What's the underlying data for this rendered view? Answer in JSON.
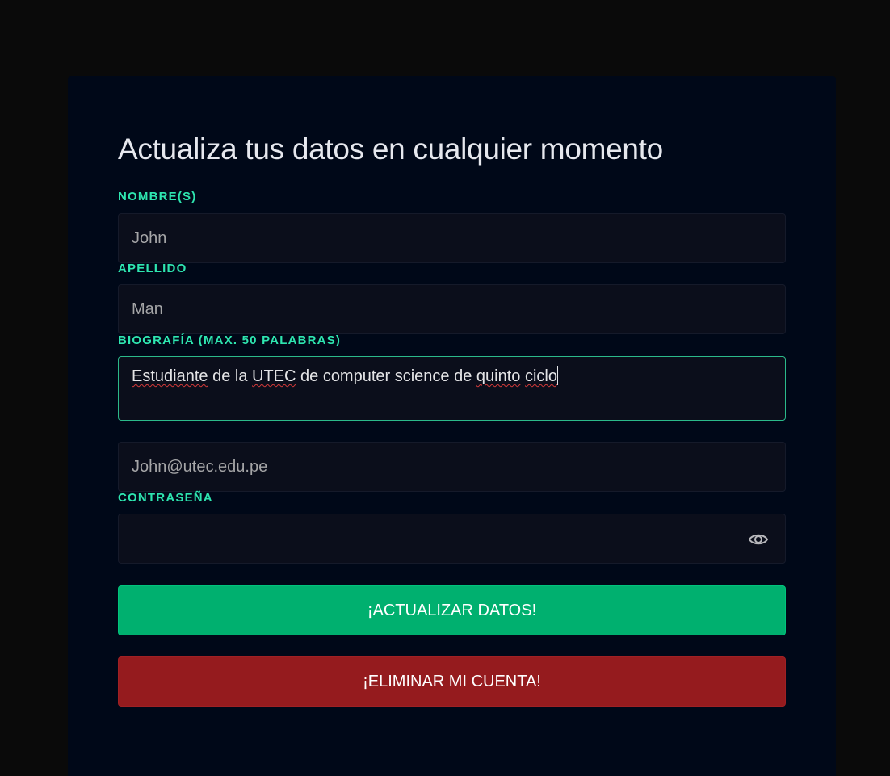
{
  "form": {
    "title": "Actualiza tus datos en cualquier momento",
    "fields": {
      "nombre": {
        "label": "NOMBRE(S)",
        "value": "John"
      },
      "apellido": {
        "label": "APELLIDO",
        "value": "Man"
      },
      "biografia": {
        "label": "BIOGRAFÍA (MAX. 50 PALABRAS)",
        "words": [
          "Estudiante",
          " de la ",
          "UTEC",
          " de computer science de ",
          "quinto",
          " ",
          "ciclo"
        ]
      },
      "email": {
        "value": "John@utec.edu.pe"
      },
      "password": {
        "label": "CONTRASEÑA",
        "value": "",
        "toggle_icon": "eye-icon"
      }
    },
    "buttons": {
      "update": "¡ACTUALIZAR DATOS!",
      "delete": "¡ELIMINAR MI CUENTA!"
    },
    "colors": {
      "accent": "#2ee6b0",
      "update_button": "#00b06f",
      "delete_button": "#951b1e",
      "card_background": "#000818"
    }
  }
}
